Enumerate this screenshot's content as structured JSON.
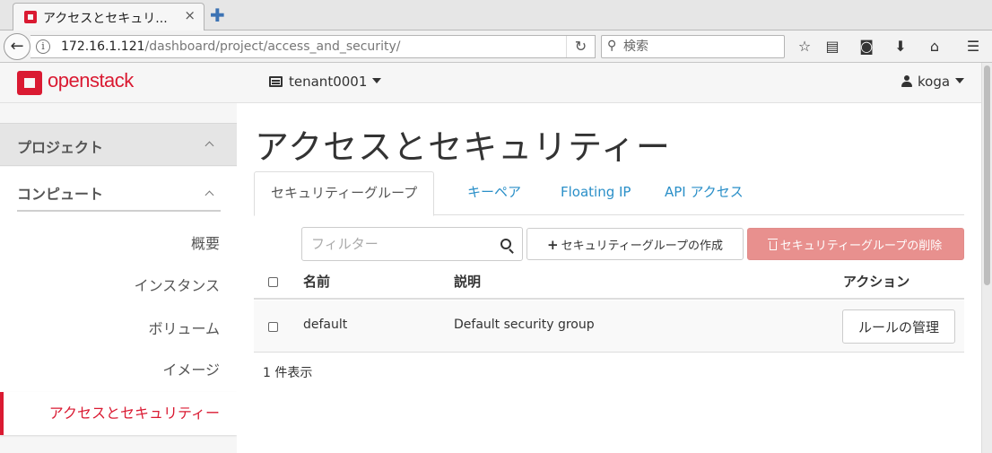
{
  "browser": {
    "tab_title": "アクセスとセキュリ...",
    "tab_close": "×",
    "newtab": "✚",
    "back": "←",
    "info": "i",
    "url_host": "172.16.1.121",
    "url_path": "/dashboard/project/access_and_security/",
    "reload": "↻",
    "search_placeholder": "検索",
    "toolbar_icons": [
      "bookmark-star-icon",
      "reading-list-icon",
      "pocket-icon",
      "download-icon",
      "home-icon",
      "menu-icon"
    ]
  },
  "header": {
    "logo_text": "openstack",
    "tenant": "tenant0001",
    "user": "koga"
  },
  "sidebar": {
    "project": "プロジェクト",
    "compute": "コンピュート",
    "items": [
      {
        "label": "概要"
      },
      {
        "label": "インスタンス"
      },
      {
        "label": "ボリューム"
      },
      {
        "label": "イメージ"
      },
      {
        "label": "アクセスとセキュリティー",
        "active": true
      }
    ]
  },
  "main": {
    "title": "アクセスとセキュリティー",
    "tabs": [
      {
        "label": "セキュリティーグループ",
        "active": true
      },
      {
        "label": "キーペア"
      },
      {
        "label": "Floating IP"
      },
      {
        "label": "API アクセス"
      }
    ],
    "filter_placeholder": "フィルター",
    "create_button": "セキュリティーグループの作成",
    "delete_button": "セキュリティーグループの削除",
    "table": {
      "headers": {
        "name": "名前",
        "description": "説明",
        "actions": "アクション"
      },
      "rows": [
        {
          "name": "default",
          "description": "Default security group",
          "action": "ルールの管理"
        }
      ]
    },
    "count_text": "1 件表示"
  },
  "colors": {
    "brand_red": "#da1a32",
    "link_blue": "#2a8fc8",
    "delete_button_bg": "#e8908e"
  }
}
